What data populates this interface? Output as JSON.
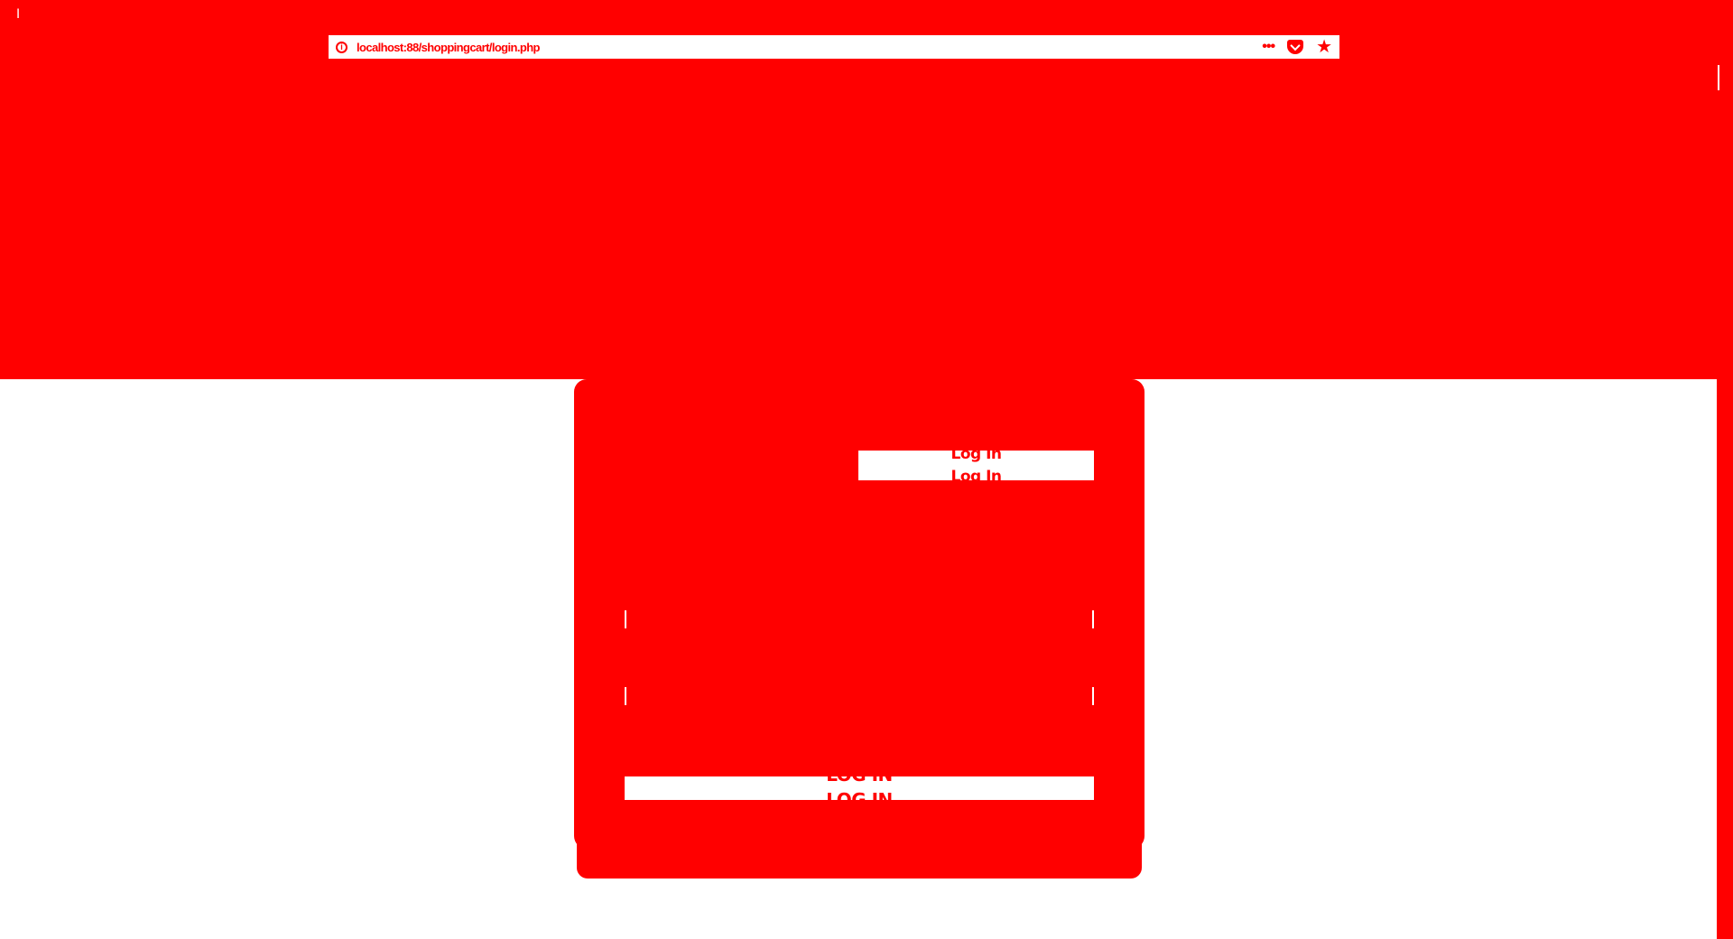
{
  "browser": {
    "url": "localhost:88/shoppingcart/login.php",
    "menu_icon": "more-dots-icon",
    "pocket_icon": "pocket-icon",
    "bookmark_icon": "star-icon"
  },
  "hero": {
    "title": "",
    "subtitle": ""
  },
  "login_card": {
    "tab_label": "Log In",
    "tab_label_echo": "Log In",
    "username_value": "",
    "password_value": "",
    "forgot_link": "",
    "submit_label": "LOG IN",
    "submit_label_echo": "LOG IN"
  },
  "colors": {
    "accent": "#ff0000",
    "foreground": "#ffffff"
  }
}
